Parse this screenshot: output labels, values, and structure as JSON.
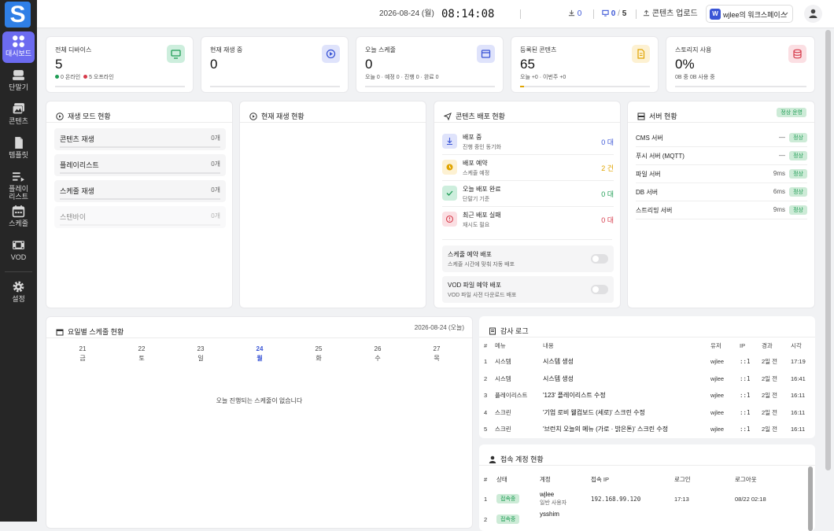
{
  "sidebar": {
    "logo": "S",
    "items": [
      {
        "label": "대시보드"
      },
      {
        "label": "단말기"
      },
      {
        "label": "콘텐츠"
      },
      {
        "label": "템플릿"
      },
      {
        "label": "플레이\n리스트"
      },
      {
        "label": "스케줄"
      },
      {
        "label": "VOD"
      },
      {
        "label": "설정"
      }
    ]
  },
  "topbar": {
    "date": "2026-08-24 (월)",
    "time": "08:14:08",
    "downloads": "0",
    "devices_on": "0",
    "devices_total": "5",
    "upload_label": "콘텐츠 업로드",
    "workspace_letter": "W",
    "workspace": "wjlee의 워크스페이스"
  },
  "stats": [
    {
      "label": "전체 디바이스",
      "value": "5",
      "sub_a": "0 온라인",
      "sub_b": "5 오프라인"
    },
    {
      "label": "현재 재생 중",
      "value": "0",
      "sub": ""
    },
    {
      "label": "오늘 스케줄",
      "value": "0",
      "sub": "오늘 0 · 예정 0 · 진행 0 · 완료 0"
    },
    {
      "label": "등록된 콘텐츠",
      "value": "65",
      "sub": "오늘 +0 · 이번주 +0"
    },
    {
      "label": "스토리지 사용",
      "value": "0%",
      "sub": "0B 중 0B 사용 중"
    }
  ],
  "play_mode": {
    "title": "재생 모드 현황",
    "rows": [
      {
        "label": "콘텐츠 재생",
        "count": "0개"
      },
      {
        "label": "플레이리스트",
        "count": "0개"
      },
      {
        "label": "스케줄 재생",
        "count": "0개"
      },
      {
        "label": "스탠바이",
        "count": "0개"
      }
    ]
  },
  "now_playing": {
    "title": "현재 재생 현황"
  },
  "deploy": {
    "title": "콘텐츠 배포 현황",
    "rows": [
      {
        "title": "배포 중",
        "sub": "진행 중인 동기화",
        "value": "0 대",
        "color": "#3a55d6"
      },
      {
        "title": "배포 예약",
        "sub": "스케줄 예정",
        "value": "2 건",
        "color": "#e0a400"
      },
      {
        "title": "오늘 배포 완료",
        "sub": "단말기 기준",
        "value": "0 대",
        "color": "#1f9d55"
      },
      {
        "title": "최근 배포 실패",
        "sub": "재시도 필요",
        "value": "0 대",
        "color": "#d63a4a"
      }
    ],
    "toggles": [
      {
        "title": "스케줄 예약 배포",
        "sub": "스케줄 시간에 맞춰 자동 배포"
      },
      {
        "title": "VOD 파일 예약 배포",
        "sub": "VOD 파일 사전 다운로드 배포"
      }
    ]
  },
  "server": {
    "title": "서버 현황",
    "status": "정상 운영",
    "rows": [
      {
        "name": "CMS 서버",
        "latency": "—",
        "status": "정상"
      },
      {
        "name": "푸시 서버 (MQTT)",
        "latency": "—",
        "status": "정상"
      },
      {
        "name": "파일 서버",
        "latency": "9ms",
        "status": "정상"
      },
      {
        "name": "DB 서버",
        "latency": "6ms",
        "status": "정상"
      },
      {
        "name": "스트리밍 서버",
        "latency": "9ms",
        "status": "정상"
      }
    ]
  },
  "weekly": {
    "title": "요일별 스케줄 현황",
    "date": "2026-08-24 (오늘)",
    "days": [
      {
        "d": "21",
        "w": "금"
      },
      {
        "d": "22",
        "w": "토"
      },
      {
        "d": "23",
        "w": "일"
      },
      {
        "d": "24",
        "w": "월"
      },
      {
        "d": "25",
        "w": "화"
      },
      {
        "d": "26",
        "w": "수"
      },
      {
        "d": "27",
        "w": "목"
      }
    ],
    "empty": "오늘 진행되는 스케줄이 없습니다"
  },
  "audit": {
    "title": "감사 로그",
    "headers": [
      "#",
      "메뉴",
      "내용",
      "유저",
      "IP",
      "경과",
      "시각"
    ],
    "rows": [
      [
        "1",
        "시스템",
        "시스템 생성",
        "wjlee",
        "::1",
        "2일 전",
        "17:19"
      ],
      [
        "2",
        "시스템",
        "시스템 생성",
        "wjlee",
        "::1",
        "2일 전",
        "16:41"
      ],
      [
        "3",
        "플레이리스트",
        "'123' 플레이리스트 수정",
        "wjlee",
        "::1",
        "2일 전",
        "16:11"
      ],
      [
        "4",
        "스크린",
        "'기업 로비 웰컴보드 (세로)' 스크린 수정",
        "wjlee",
        "::1",
        "2일 전",
        "16:11"
      ],
      [
        "5",
        "스크린",
        "'브런치 오늘의 메뉴 (가로 · 밝은톤)' 스크린 수정",
        "wjlee",
        "::1",
        "2일 전",
        "16:11"
      ]
    ]
  },
  "sessions": {
    "title": "접속 계정 현황",
    "headers": [
      "#",
      "상태",
      "계정",
      "접속 IP",
      "로그인",
      "로그아웃"
    ],
    "rows": [
      {
        "n": "1",
        "status": "접속중",
        "account": "wjlee",
        "role": "일반 사용자",
        "ip": "192.168.99.120",
        "login": "17:13",
        "logout": "08/22 02:18"
      },
      {
        "n": "2",
        "status": "접속중",
        "account": "ysshim",
        "role": "",
        "ip": "",
        "login": "",
        "logout": ""
      }
    ]
  }
}
